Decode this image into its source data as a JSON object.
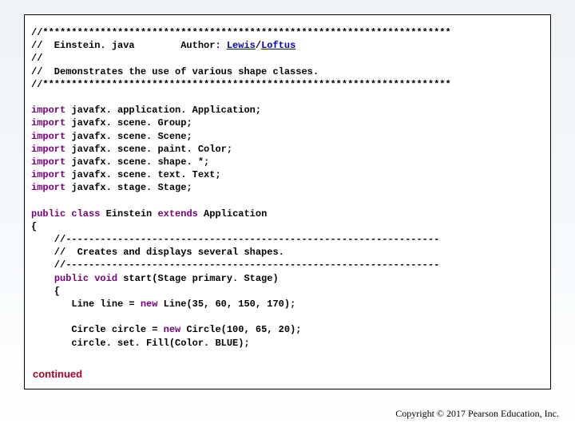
{
  "header": {
    "stars": "//***********************************************************************",
    "file_line_prefix": "//  Einstein. java        Author: ",
    "author1": "Lewis",
    "slash": "/",
    "author2": "Loftus",
    "blank": "//",
    "desc": "//  Demonstrates the use of various shape classes."
  },
  "imports": [
    {
      "kw": "import",
      "rest": " javafx. application. Application;"
    },
    {
      "kw": "import",
      "rest": " javafx. scene. Group;"
    },
    {
      "kw": "import",
      "rest": " javafx. scene. Scene;"
    },
    {
      "kw": "import",
      "rest": " javafx. scene. paint. Color;"
    },
    {
      "kw": "import",
      "rest": " javafx. scene. shape. *;"
    },
    {
      "kw": "import",
      "rest": " javafx. scene. text. Text;"
    },
    {
      "kw": "import",
      "rest": " javafx. stage. Stage;"
    }
  ],
  "classdecl": {
    "kw1": "public class",
    "name": " Einstein ",
    "kw2": "extends",
    "rest": " Application"
  },
  "body": {
    "brace_open": "{",
    "dashes": "    //-----------------------------------------------------------------",
    "method_comment": "    //  Creates and displays several shapes.",
    "method_sig_prefix": "    ",
    "method_kw": "public void",
    "method_rest": " start(Stage primary. Stage)",
    "method_brace": "    {",
    "line_decl_indent": "       Line line = ",
    "line_kw": "new",
    "line_rest": " Line(35, 60, 150, 170);",
    "circle_decl_indent": "       Circle circle = ",
    "circle_kw": "new",
    "circle_rest": " Circle(100, 65, 20);",
    "circle_fill": "       circle. set. Fill(Color. BLUE);"
  },
  "continued": "continued",
  "copyright": "Copyright © 2017 Pearson Education, Inc."
}
